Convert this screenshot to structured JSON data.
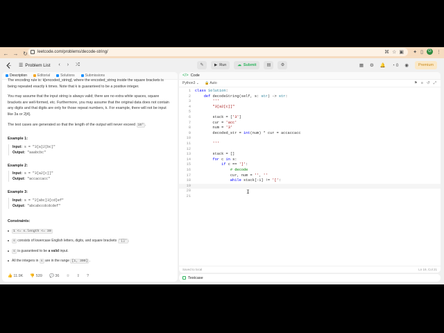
{
  "browser": {
    "url": "leetcode.com/problems/decode-string/",
    "back": "←",
    "forward": "→",
    "reload": "↻",
    "avatar": "G"
  },
  "nav": {
    "problem_list": "Problem List",
    "run": "Run",
    "submit": "Submit",
    "premium": "Premium",
    "notif_count": "0"
  },
  "tabs": [
    {
      "label": "Description",
      "color": "#1a90ff"
    },
    {
      "label": "Editorial",
      "color": "#f5a623"
    },
    {
      "label": "Solutions",
      "color": "#1a90ff"
    },
    {
      "label": "Submissions",
      "color": "#1a90ff"
    }
  ],
  "description": {
    "p0": "The encoding rule is: k[encoded_string], where the encoded_string inside the square brackets is being repeated exactly k times. Note that k is guaranteed to be a positive integer.",
    "p1": "You may assume that the input string is always valid; there are no extra white spaces, square brackets are well-formed, etc. Furthermore, you may assume that the original data does not contain any digits and that digits are only for those repeat numbers, k. For example, there will not be input like 3a or 2[4].",
    "p2_before": "The test cases are generated so that the length of the output will never exceed ",
    "p2_code": "10⁵",
    "p2_after": ".",
    "examples": [
      {
        "title": "Example 1:",
        "input": "s = \"3[a]2[bc]\"",
        "output": "\"aaabcbc\""
      },
      {
        "title": "Example 2:",
        "input": "s = \"3[a2[c]]\"",
        "output": "\"accaccacc\""
      },
      {
        "title": "Example 3:",
        "input": "s = \"2[abc]3[cd]ef\"",
        "output": "\"abcabccdcdcdef\""
      }
    ],
    "input_label": "Input:",
    "output_label": "Output:",
    "constraints_title": "Constraints:",
    "c1": "1 <= s.length <= 30",
    "c2_code": "s",
    "c2_text": " consists of lowercase English letters, digits, and square brackets ",
    "c2_code2": "'[]'",
    "c2_end": ".",
    "c3_code": "s",
    "c3_text": " is guaranteed to be ",
    "c3_bold": "a valid",
    "c3_end": " input.",
    "c4_text": "All the integers in ",
    "c4_code": "s",
    "c4_text2": " are in the range ",
    "c4_code2": "[1, 300]",
    "c4_end": "."
  },
  "footer": {
    "likes": "11.9K",
    "dislikes": "539",
    "comments": "36"
  },
  "code_panel": {
    "title": "Code",
    "language": "Python3",
    "auto": "Auto",
    "saved": "Saved to local",
    "cursor_pos": "Ln 19, Col 21"
  },
  "testcase": {
    "label": "Testcase"
  }
}
